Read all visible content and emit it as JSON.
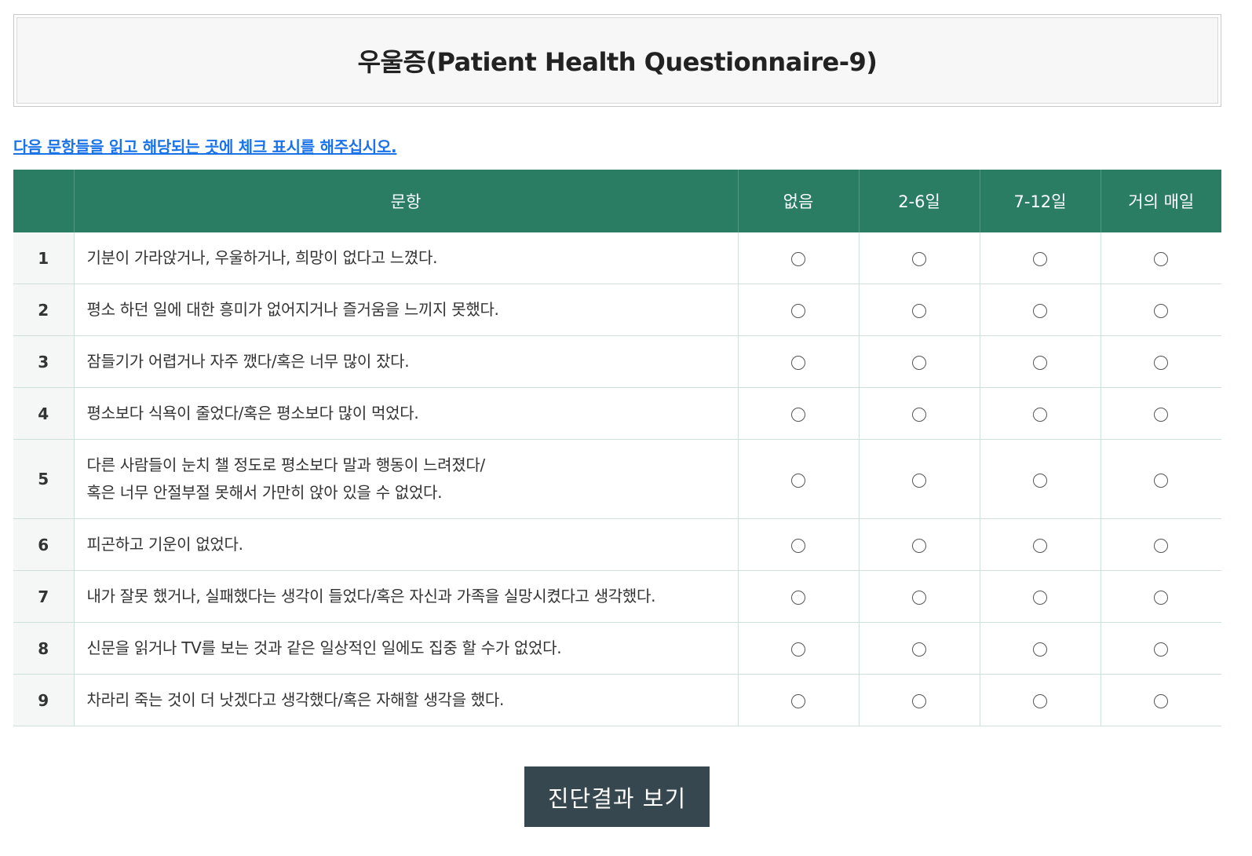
{
  "header": {
    "title": "우울증(Patient Health Questionnaire-9)"
  },
  "instruction": "다음 문항들을 읽고 해당되는 곳에 체크 표시를 해주십시오.",
  "table": {
    "columns": {
      "number": "",
      "question": "문항",
      "opt0": "없음",
      "opt1": "2-6일",
      "opt2": "7-12일",
      "opt3": "거의 매일"
    },
    "rows": [
      {
        "num": "1",
        "line1": "기분이 가라앉거나, 우울하거나, 희망이 없다고 느꼈다.",
        "line2": ""
      },
      {
        "num": "2",
        "line1": "평소 하던 일에 대한 흥미가 없어지거나 즐거움을 느끼지 못했다.",
        "line2": ""
      },
      {
        "num": "3",
        "line1": "잠들기가 어렵거나 자주 깼다/혹은 너무 많이 잤다.",
        "line2": ""
      },
      {
        "num": "4",
        "line1": "평소보다 식욕이 줄었다/혹은 평소보다 많이 먹었다.",
        "line2": ""
      },
      {
        "num": "5",
        "line1": "다른 사람들이 눈치 챌 정도로 평소보다 말과 행동이 느려졌다/",
        "line2": "혹은 너무 안절부절 못해서 가만히 앉아 있을 수 없었다."
      },
      {
        "num": "6",
        "line1": "피곤하고 기운이 없었다.",
        "line2": ""
      },
      {
        "num": "7",
        "line1": "내가 잘못 했거나, 실패했다는 생각이 들었다/혹은 자신과 가족을 실망시켰다고 생각했다.",
        "line2": ""
      },
      {
        "num": "8",
        "line1": "신문을 읽거나 TV를 보는 것과 같은 일상적인 일에도 집중 할 수가 없었다.",
        "line2": ""
      },
      {
        "num": "9",
        "line1": "차라리 죽는 것이 더 낫겠다고 생각했다/혹은 자해할 생각을 했다.",
        "line2": ""
      }
    ]
  },
  "submit_label": "진단결과 보기",
  "colors": {
    "header_bg": "#2a7d62",
    "button_bg": "#37474f",
    "link": "#1a73e8"
  }
}
